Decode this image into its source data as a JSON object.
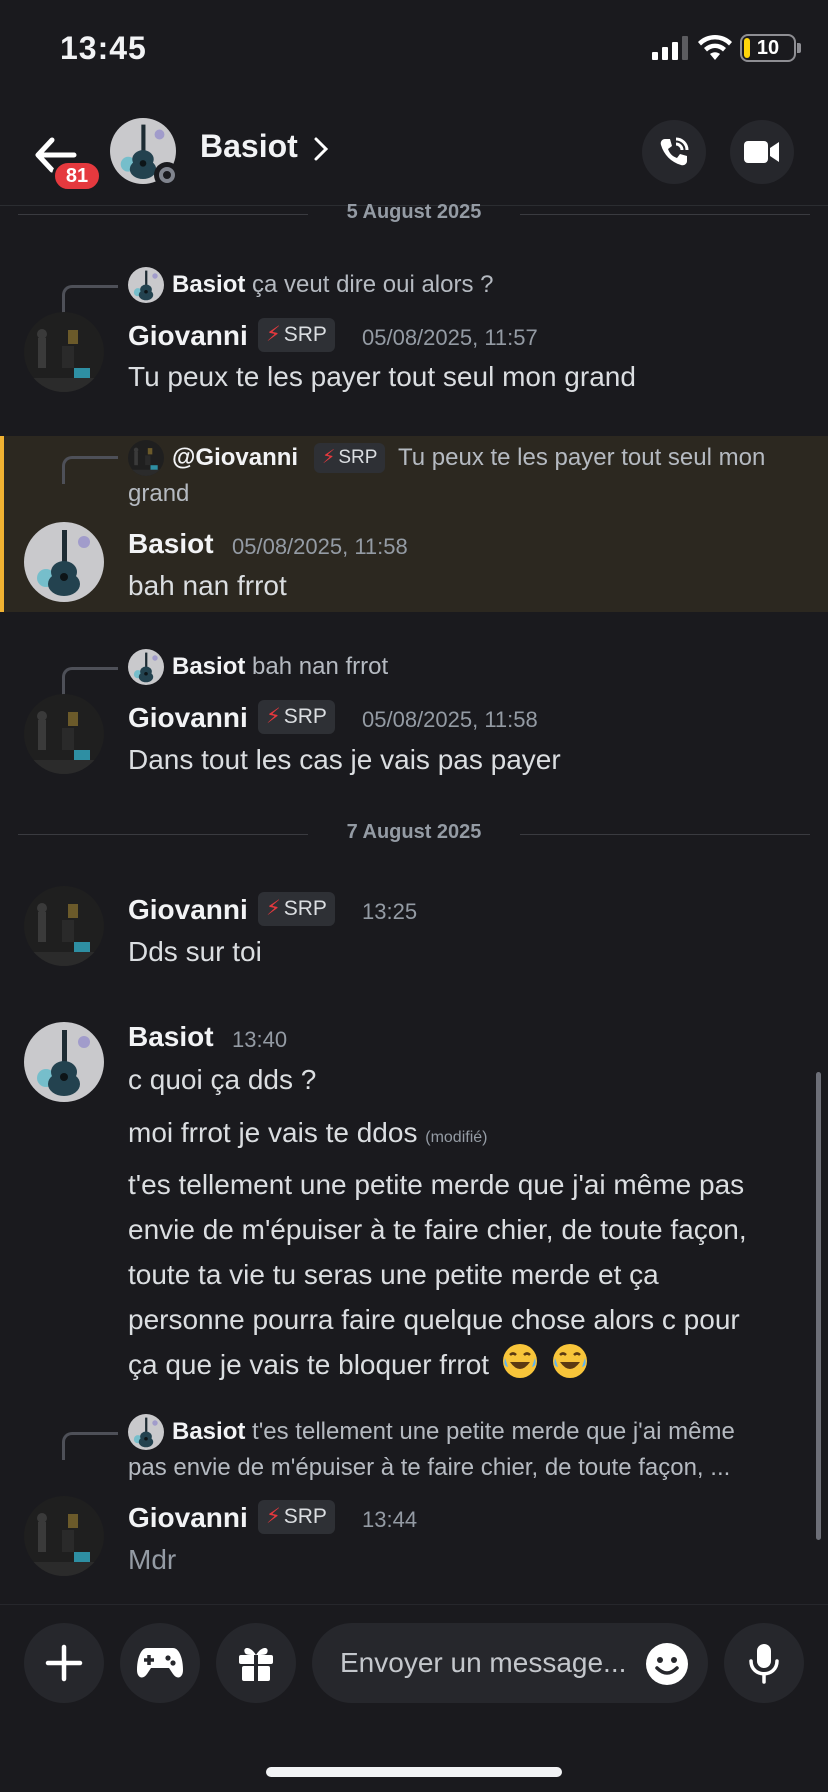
{
  "status_bar": {
    "time": "13:45",
    "battery": "10"
  },
  "header": {
    "name": "Basiot",
    "unread_badge": "81"
  },
  "dates": [
    "5 August 2025",
    "7 August 2025"
  ],
  "messages": [
    {
      "reply": {
        "author": "Basiot",
        "text": "ça veut dire oui alors ?"
      },
      "author": "Giovanni",
      "tag": "SRP",
      "time": "05/08/2025, 11:57",
      "lines": [
        "Tu peux te les payer tout seul mon grand"
      ]
    },
    {
      "reply": {
        "author": "@Giovanni",
        "tag": "SRP",
        "text_line1": "Tu peux te les payer tout seul mon",
        "text_line2": "grand"
      },
      "author": "Basiot",
      "time": "05/08/2025, 11:58",
      "lines": [
        "bah nan frrot"
      ]
    },
    {
      "reply": {
        "author": "Basiot",
        "text": "bah nan frrot"
      },
      "author": "Giovanni",
      "tag": "SRP",
      "time": "05/08/2025, 11:58",
      "lines": [
        "Dans tout les cas je vais pas payer"
      ]
    },
    {
      "author": "Giovanni",
      "tag": "SRP",
      "time": "13:25",
      "lines": [
        "Dds sur toi"
      ]
    },
    {
      "author": "Basiot",
      "time": "13:40",
      "lines": [
        "c quoi ça dds ?",
        "moi frrot je vais te ddos"
      ],
      "edited": "(modifié)",
      "long": [
        "t'es tellement une petite merde que j'ai même pas",
        "envie de m'épuiser à te faire chier, de toute façon,",
        "toute ta vie tu seras une petite merde et ça",
        "personne pourra faire quelque chose alors c pour",
        "ça que je vais te bloquer frrot"
      ]
    },
    {
      "reply": {
        "author": "Basiot",
        "text_line1": "t'es tellement une petite merde que j'ai même",
        "text_line2": "pas envie de m'épuiser à te faire chier, de toute façon, ..."
      },
      "author": "Giovanni",
      "tag": "SRP",
      "time": "13:44",
      "lines": [
        "Mdr"
      ]
    }
  ],
  "composer": {
    "placeholder": "Envoyer un message..."
  },
  "icons": {
    "back": "back-arrow-icon",
    "call": "phone-call-icon",
    "video": "video-camera-icon",
    "add": "plus-icon",
    "games": "gamepad-icon",
    "gift": "gift-icon",
    "emoji": "emoji-smile-icon",
    "mic": "microphone-icon"
  },
  "colors": {
    "background": "#1a1a1e",
    "highlight": "#2c2820",
    "highlight_bar": "#f0b232",
    "badge": "#e5393e",
    "bolt": "#e5393e"
  }
}
